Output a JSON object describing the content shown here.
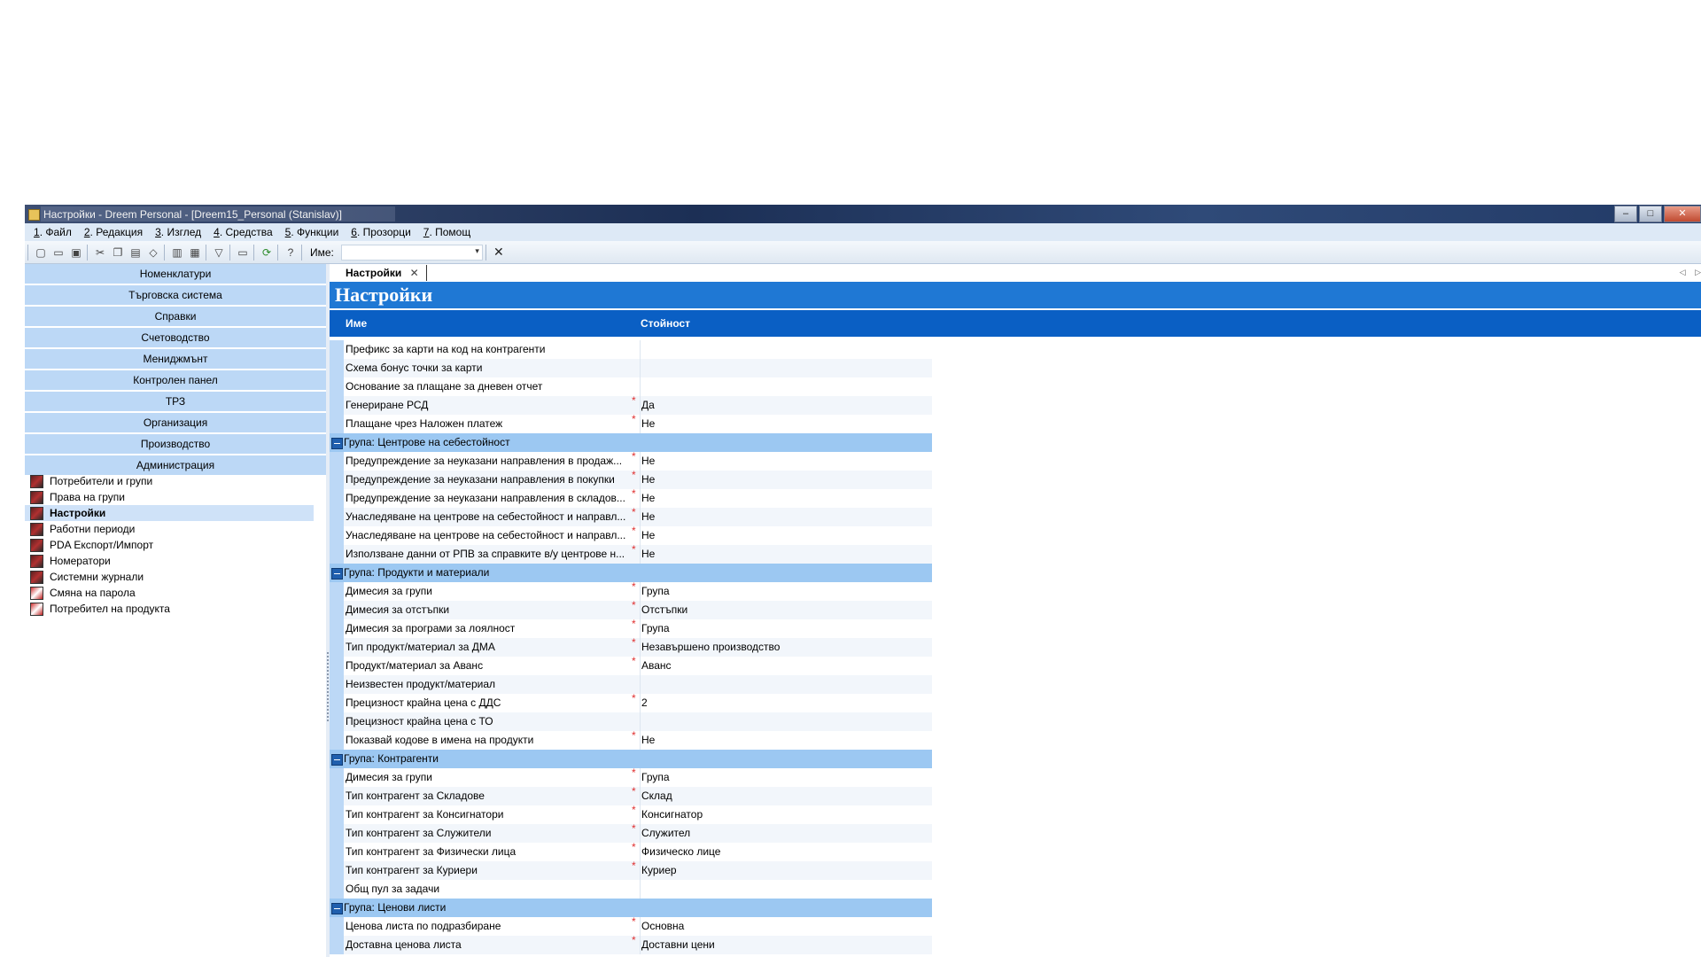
{
  "window": {
    "title": "Настройки - Dreem Personal - [Dreem15_Personal (Stanislav)]",
    "controls": {
      "minimize": "–",
      "maximize": "□",
      "close": "✕"
    }
  },
  "menu": [
    {
      "num": "1",
      "label": ". Файл"
    },
    {
      "num": "2",
      "label": ". Редакция"
    },
    {
      "num": "3",
      "label": ". Изглед"
    },
    {
      "num": "4",
      "label": ". Средства"
    },
    {
      "num": "5",
      "label": ". Функции"
    },
    {
      "num": "6",
      "label": ". Прозорци"
    },
    {
      "num": "7",
      "label": ". Помощ"
    }
  ],
  "toolbar": {
    "name_label": "Име:",
    "name_value": "",
    "icons": [
      "new-document-icon",
      "open-folder-icon",
      "save-icon",
      "cut-icon",
      "copy-icon",
      "paste-icon",
      "eraser-icon",
      "print-icon",
      "print-preview-icon",
      "filter-icon",
      "window-icon",
      "refresh-icon",
      "help-icon"
    ],
    "clear_glyph": "✕",
    "combo_arrow": "▾"
  },
  "nav": {
    "modules": [
      "Номенклатури",
      "Търговска система",
      "Справки",
      "Счетоводство",
      "Мениджмънт",
      "Контролен панел",
      "ТРЗ",
      "Организация",
      "Производство",
      "Администрация"
    ],
    "items": [
      {
        "label": "Потребители и групи",
        "selected": false,
        "icon": "users-icon"
      },
      {
        "label": "Права на групи",
        "selected": false,
        "icon": "rights-icon"
      },
      {
        "label": "Настройки",
        "selected": true,
        "icon": "settings-icon"
      },
      {
        "label": "Работни периоди",
        "selected": false,
        "icon": "periods-icon"
      },
      {
        "label": "PDA Експорт/Импорт",
        "selected": false,
        "icon": "pda-icon"
      },
      {
        "label": "Номератори",
        "selected": false,
        "icon": "numerators-icon"
      },
      {
        "label": "Системни журнали",
        "selected": false,
        "icon": "journal-icon"
      },
      {
        "label": "Смяна на парола",
        "selected": false,
        "icon": "password-icon"
      },
      {
        "label": "Потребител на продукта",
        "selected": false,
        "icon": "product-user-icon"
      }
    ]
  },
  "tab": {
    "label": "Настройки",
    "close": "✕",
    "nav_left": "◁",
    "nav_right": "▷"
  },
  "page": {
    "title": "Настройки",
    "col_name": "Име",
    "col_value": "Стойност"
  },
  "rows": [
    {
      "type": "row",
      "name": "Префикс за карти на код на контрагенти",
      "value": "",
      "required": false
    },
    {
      "type": "row",
      "name": "Схема бонус точки за карти",
      "value": "",
      "required": false
    },
    {
      "type": "row",
      "name": "Основание за плащане за дневен отчет",
      "value": "",
      "required": false
    },
    {
      "type": "row",
      "name": "Генериране РСД",
      "value": "Да",
      "required": true
    },
    {
      "type": "row",
      "name": "Плащане чрез Наложен платеж",
      "value": "Не",
      "required": true
    },
    {
      "type": "group",
      "name": "Група: Центрове на себестойност"
    },
    {
      "type": "row",
      "name": "Предупреждение за неуказани направления в продаж...",
      "value": "Не",
      "required": true
    },
    {
      "type": "row",
      "name": "Предупреждение за неуказани направления в покупки",
      "value": "Не",
      "required": true
    },
    {
      "type": "row",
      "name": "Предупреждение за неуказани направления в складов...",
      "value": "Не",
      "required": true
    },
    {
      "type": "row",
      "name": "Унаследяване на центрове на себестойност и направл...",
      "value": "Не",
      "required": true
    },
    {
      "type": "row",
      "name": "Унаследяване на центрове на себестойност и направл...",
      "value": "Не",
      "required": true
    },
    {
      "type": "row",
      "name": "Използване данни от РПВ за справките в/у центрове н...",
      "value": "Не",
      "required": true
    },
    {
      "type": "group",
      "name": "Група: Продукти и материали"
    },
    {
      "type": "row",
      "name": "Димесия за групи",
      "value": "Група",
      "required": true
    },
    {
      "type": "row",
      "name": "Димесия за отстъпки",
      "value": "Отстъпки",
      "required": true
    },
    {
      "type": "row",
      "name": "Димесия за програми за лоялност",
      "value": "Група",
      "required": true
    },
    {
      "type": "row",
      "name": "Тип продукт/материал за ДМА",
      "value": "Незавършено производство",
      "required": true
    },
    {
      "type": "row",
      "name": "Продукт/материал за Аванс",
      "value": "Аванс",
      "required": true
    },
    {
      "type": "row",
      "name": "Неизвестен продукт/материал",
      "value": "",
      "required": false
    },
    {
      "type": "row",
      "name": "Прецизност крайна цена с ДДС",
      "value": "2",
      "required": true
    },
    {
      "type": "row",
      "name": "Прецизност крайна цена с ТО",
      "value": "",
      "required": false
    },
    {
      "type": "row",
      "name": "Показвай кодове в имена на продукти",
      "value": "Не",
      "required": true
    },
    {
      "type": "group",
      "name": "Група: Контрагенти"
    },
    {
      "type": "row",
      "name": "Димесия за групи",
      "value": "Група",
      "required": true
    },
    {
      "type": "row",
      "name": "Тип контрагент за Складове",
      "value": "Склад",
      "required": true
    },
    {
      "type": "row",
      "name": "Тип контрагент за Консигнатори",
      "value": "Консигнатор",
      "required": true
    },
    {
      "type": "row",
      "name": "Тип контрагент за Служители",
      "value": "Служител",
      "required": true
    },
    {
      "type": "row",
      "name": "Тип контрагент за Физически лица",
      "value": "Физическо лице",
      "required": true
    },
    {
      "type": "row",
      "name": "Тип контрагент за Куриери",
      "value": "Куриер",
      "required": true
    },
    {
      "type": "row",
      "name": "Общ пул за задачи",
      "value": "",
      "required": false
    },
    {
      "type": "group",
      "name": "Група: Ценови листи"
    },
    {
      "type": "row",
      "name": "Ценова листа по подразбиране",
      "value": "Основна",
      "required": true
    },
    {
      "type": "row",
      "name": "Доставна ценова листа",
      "value": "Доставни цени",
      "required": true
    }
  ],
  "required_mark": "*"
}
